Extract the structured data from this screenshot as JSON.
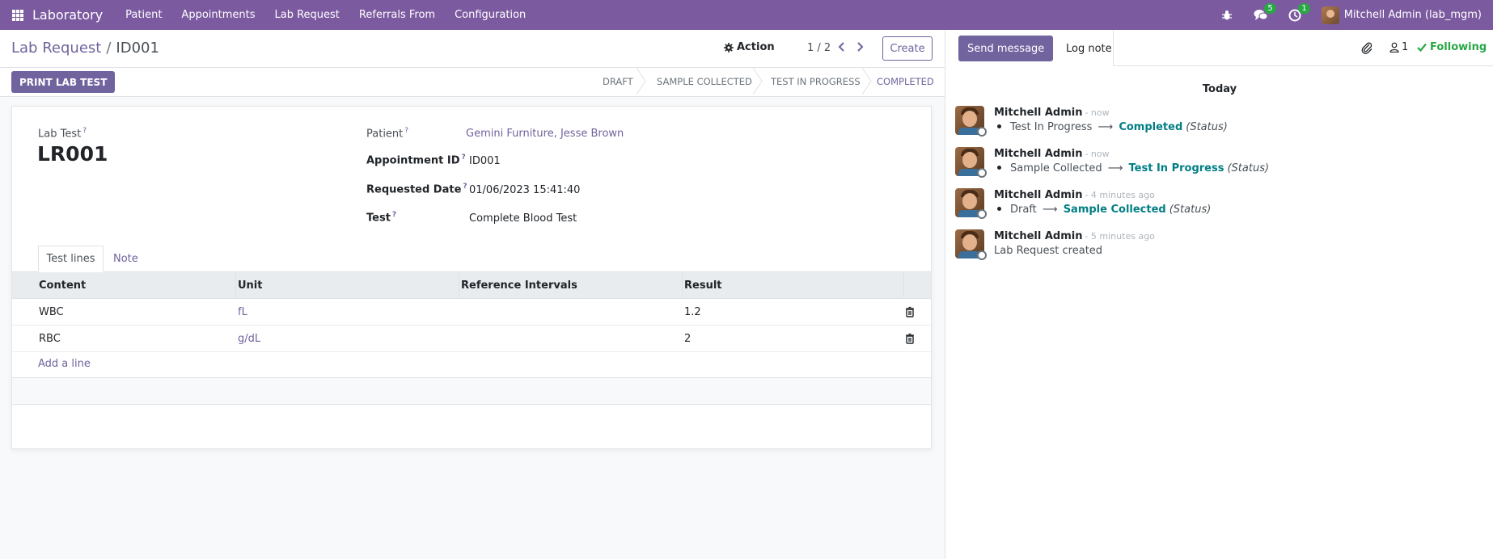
{
  "navbar": {
    "brand": "Laboratory",
    "menu": [
      "Patient",
      "Appointments",
      "Lab Request",
      "Referrals From",
      "Configuration"
    ],
    "messages_count": "5",
    "activities_count": "1",
    "user": "Mitchell Admin (lab_mgm)"
  },
  "control": {
    "breadcrumb_parent": "Lab Request",
    "breadcrumb_sep": "/",
    "breadcrumb_current": "ID001",
    "action_label": "Action",
    "pager": "1 / 2",
    "create_label": "Create"
  },
  "statusbar": {
    "print_label": "PRINT LAB TEST",
    "stages": [
      "DRAFT",
      "SAMPLE COLLECTED",
      "TEST IN PROGRESS",
      "COMPLETED"
    ],
    "active_stage": "COMPLETED"
  },
  "form": {
    "lab_test_label": "Lab Test",
    "lab_test_value": "LR001",
    "help_mark": "?",
    "patient_label": "Patient",
    "patient_value": "Gemini Furniture, Jesse Brown",
    "appointment_label": "Appointment ID",
    "appointment_value": "ID001",
    "requested_date_label": "Requested Date",
    "requested_date_value": "01/06/2023 15:41:40",
    "test_label": "Test",
    "test_value": "Complete Blood Test"
  },
  "tabs": [
    "Test lines",
    "Note"
  ],
  "table": {
    "columns": [
      "Content",
      "Unit",
      "Reference Intervals",
      "Result"
    ],
    "rows": [
      {
        "content": "WBC",
        "unit": "fL",
        "reference": "",
        "result": "1.2"
      },
      {
        "content": "RBC",
        "unit": "g/dL",
        "reference": "",
        "result": "2"
      }
    ],
    "add_line": "Add a line"
  },
  "chatter": {
    "send_message": "Send message",
    "log_note": "Log note",
    "followers_count": "1",
    "following": "Following",
    "day_label": "Today",
    "messages": [
      {
        "author": "Mitchell Admin",
        "time": "- now",
        "old": "Test In Progress",
        "new": "Completed",
        "field": "(Status)"
      },
      {
        "author": "Mitchell Admin",
        "time": "- now",
        "old": "Sample Collected",
        "new": "Test In Progress",
        "field": "(Status)"
      },
      {
        "author": "Mitchell Admin",
        "time": "- 4 minutes ago",
        "old": "Draft",
        "new": "Sample Collected",
        "field": "(Status)"
      },
      {
        "author": "Mitchell Admin",
        "time": "- 5 minutes ago",
        "body": "Lab Request created"
      }
    ]
  }
}
